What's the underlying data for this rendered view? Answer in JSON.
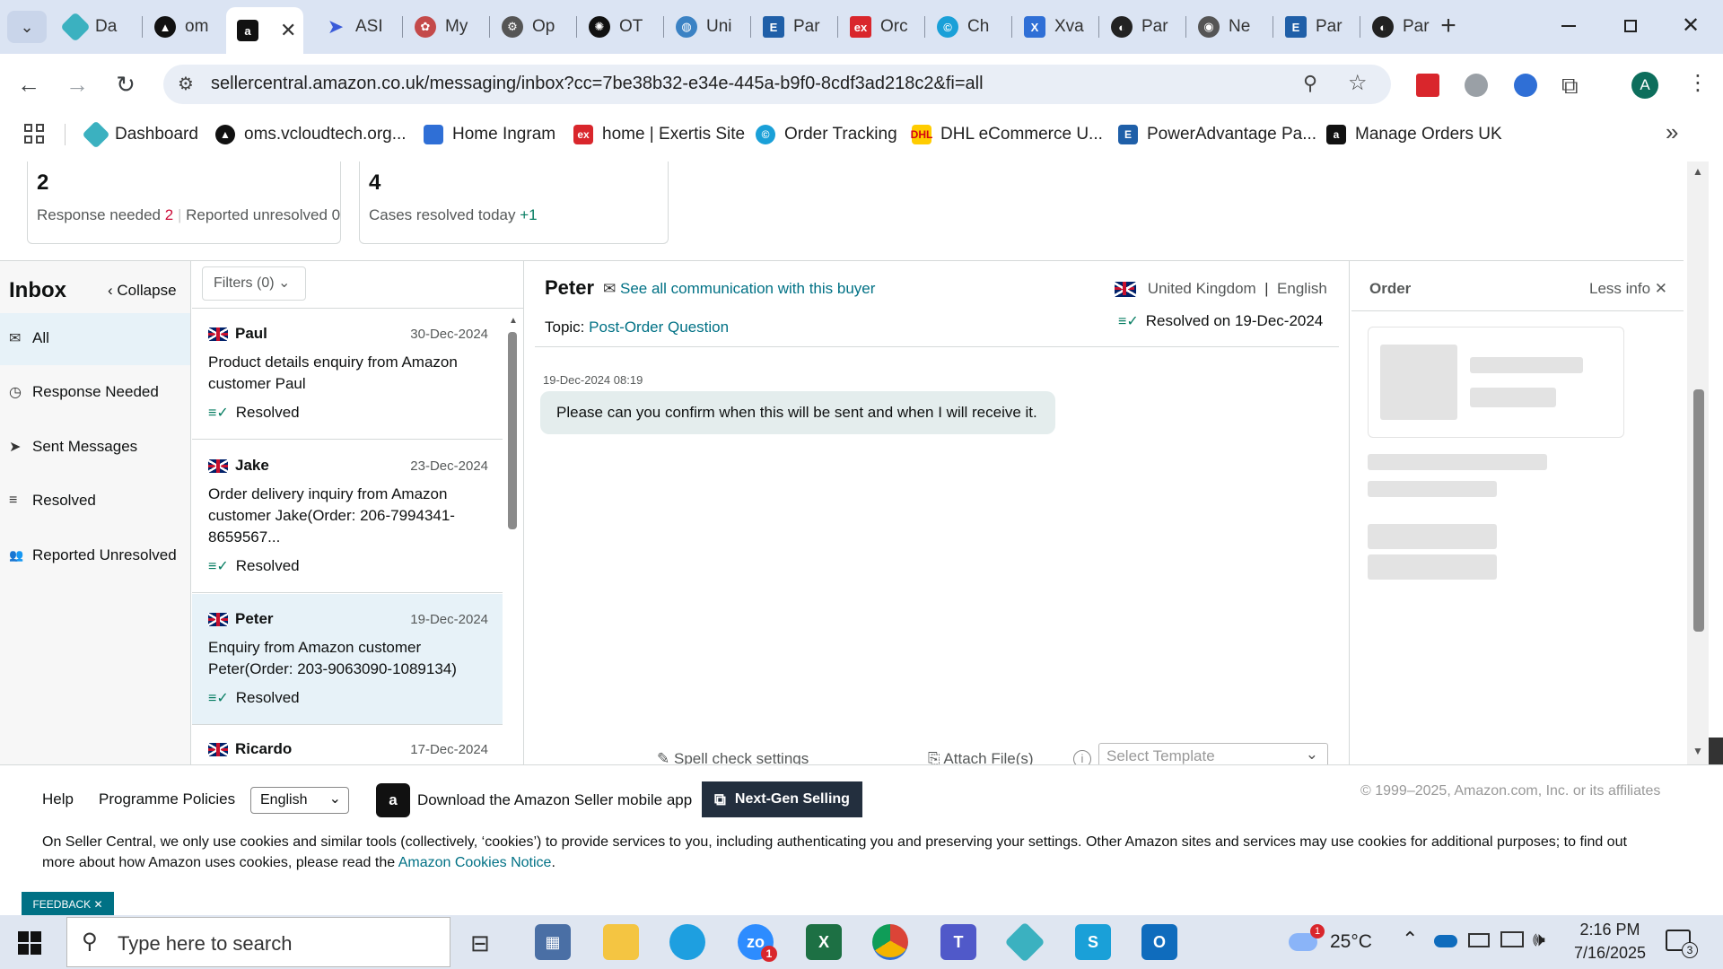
{
  "browser": {
    "tabs": [
      {
        "label": "Da",
        "color": "#3bb1c0"
      },
      {
        "label": "om",
        "color": "#111111"
      },
      {
        "label": "a",
        "color": "#111111",
        "active": true
      },
      {
        "label": "ASI",
        "color": "#3a5bd9"
      },
      {
        "label": "My",
        "color": "#c44a4a"
      },
      {
        "label": "Op",
        "color": "#333333"
      },
      {
        "label": "OT",
        "color": "#111111"
      },
      {
        "label": "Uni",
        "color": "#3b82c4"
      },
      {
        "label": "Par",
        "color": "#1f5fa8"
      },
      {
        "label": "Orc",
        "color": "#d9262c"
      },
      {
        "label": "Ch",
        "color": "#1aa0d8"
      },
      {
        "label": "Xva",
        "color": "#2f6fd6"
      },
      {
        "label": "Par",
        "color": "#222222"
      },
      {
        "label": "Ne",
        "color": "#555555"
      },
      {
        "label": "Par",
        "color": "#1f5fa8"
      },
      {
        "label": "Par",
        "color": "#222222"
      }
    ],
    "new_tab": "+",
    "url": "sellercentral.amazon.co.uk/messaging/inbox?cc=7be38b32-e34e-445a-b9f0-8cdf3ad218c2&fi=all",
    "profile_initial": "A",
    "bookmarks": [
      {
        "label": "Dashboard",
        "color": "#3bb1c0"
      },
      {
        "label": "oms.vcloudtech.org...",
        "color": "#111111"
      },
      {
        "label": "Home Ingram",
        "color": "#2f6fd6"
      },
      {
        "label": "home | Exertis Site",
        "color": "#d9262c"
      },
      {
        "label": "Order Tracking",
        "color": "#1aa0d8"
      },
      {
        "label": "DHL eCommerce U...",
        "color": "#ffcc00"
      },
      {
        "label": "PowerAdvantage Pa...",
        "color": "#1f5fa8"
      },
      {
        "label": "Manage Orders UK",
        "color": "#111111"
      }
    ],
    "more": "»"
  },
  "stats": [
    {
      "value": "2",
      "text_a": "Response needed",
      "num_a": "2",
      "text_b": "Reported unresolved",
      "num_b": "0"
    },
    {
      "value": "4",
      "text_a": "Cases resolved today",
      "num_a": "+1"
    }
  ],
  "inbox": {
    "title": "Inbox",
    "collapse": "Collapse",
    "filters": "Filters (0)",
    "nav": [
      {
        "label": "All",
        "icon": "✉"
      },
      {
        "label": "Response Needed",
        "icon": "◷"
      },
      {
        "label": "Sent Messages",
        "icon": "➤"
      },
      {
        "label": "Resolved",
        "icon": "≡"
      },
      {
        "label": "Reported Unresolved",
        "icon": "👥"
      }
    ],
    "messages": [
      {
        "name": "Paul",
        "date": "30-Dec-2024",
        "subject": "Product details enquiry from Amazon customer Paul",
        "status": "Resolved"
      },
      {
        "name": "Jake",
        "date": "23-Dec-2024",
        "subject": "Order delivery inquiry from Amazon customer Jake(Order: 206-7994341-8659567...",
        "status": "Resolved"
      },
      {
        "name": "Peter",
        "date": "19-Dec-2024",
        "subject": "Enquiry from Amazon customer Peter(Order: 203-9063090-1089134)",
        "status": "Resolved"
      },
      {
        "name": "Ricardo",
        "date": "17-Dec-2024"
      }
    ]
  },
  "conversation": {
    "buyer": "Peter",
    "see_all": "See all communication with this buyer",
    "country": "United Kingdom",
    "language": "English",
    "topic_label": "Topic:",
    "topic": "Post-Order Question",
    "resolved": "Resolved on 19-Dec-2024",
    "timestamp": "19-Dec-2024 08:19",
    "message": "Please can you confirm when this will be sent and when I will receive it.",
    "spell_check": "Spell check settings",
    "attach": "Attach File(s)",
    "template_placeholder": "Select Template"
  },
  "order_panel": {
    "title": "Order",
    "less_info": "Less info"
  },
  "footer": {
    "help": "Help",
    "policies": "Programme Policies",
    "language": "English",
    "app": "Download the Amazon Seller mobile app",
    "nextgen": "Next-Gen Selling",
    "copyright": "© 1999–2025, Amazon.com, Inc. or its affiliates",
    "cookie_text": "On Seller Central, we only use cookies and similar tools (collectively, ‘cookies’) to provide services to you, including authenticating you and preserving your settings. Other Amazon sites and services may use cookies for additional purposes; to find out more about how Amazon uses cookies, please read the",
    "cookie_link": "Amazon Cookies Notice",
    "cookie_end": ".",
    "feedback": "FEEDBACK"
  },
  "taskbar": {
    "search": "Type here to search",
    "weather": "25°C",
    "weather_badge": "1",
    "zoom_badge": "1",
    "time": "2:16 PM",
    "date": "7/16/2025",
    "notif_count": "3"
  }
}
